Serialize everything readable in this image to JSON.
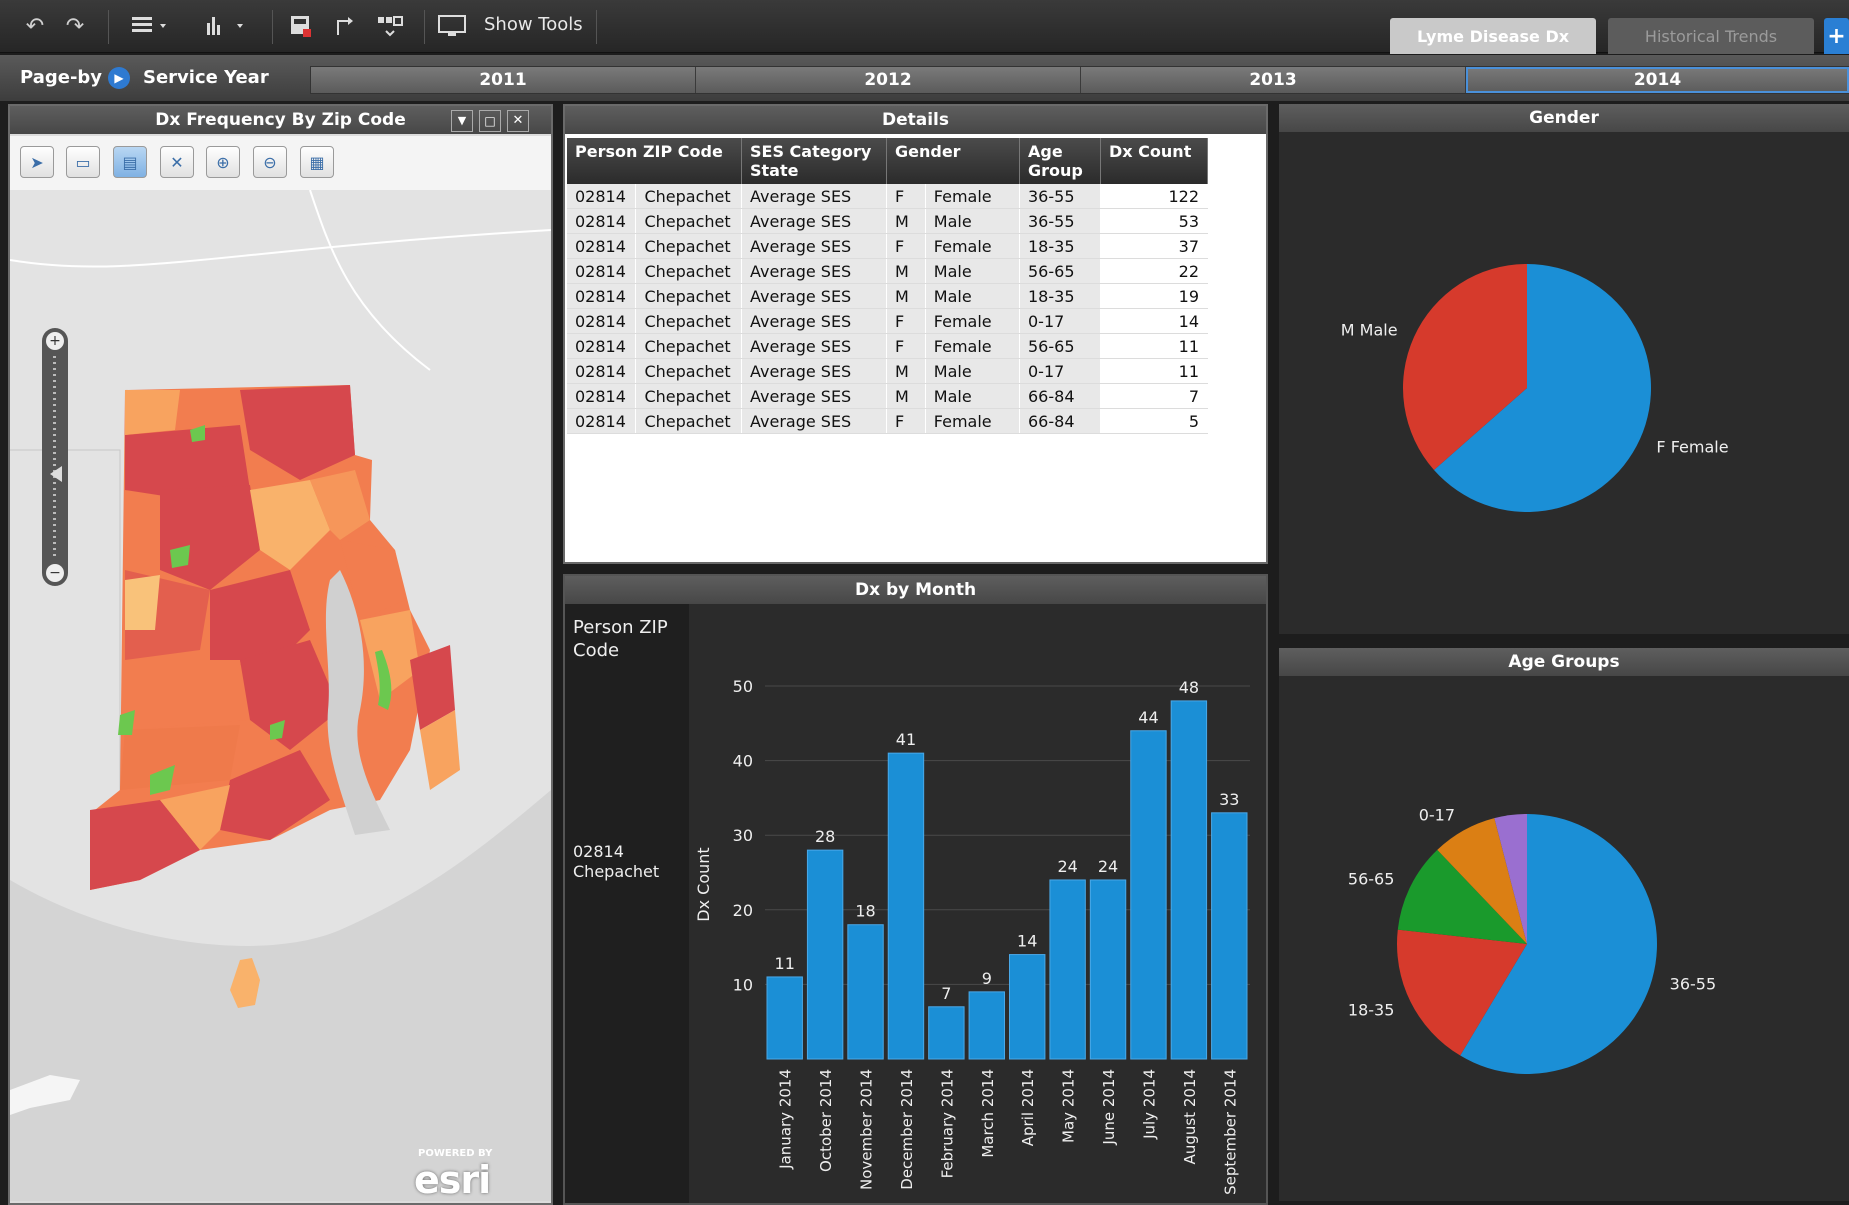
{
  "toolbar": {
    "show_tools_label": "Show Tools",
    "doc_tabs": [
      "Lyme Disease Dx",
      "Historical Trends"
    ],
    "add_tab_label": "+"
  },
  "pageby": {
    "label": "Page-by",
    "field": "Service Year",
    "years": [
      "2011",
      "2012",
      "2013",
      "2014"
    ],
    "selected": "2014"
  },
  "map": {
    "title": "Dx Frequency By Zip Code",
    "attribution_small": "POWERED BY",
    "attribution_logo": "esri"
  },
  "details": {
    "title": "Details",
    "headers": [
      "Person ZIP Code",
      "SES Category State",
      "Gender",
      "Age Group",
      "Dx Count"
    ],
    "rows": [
      [
        "02814",
        "Chepachet",
        "Average SES",
        "F",
        "Female",
        "36-55",
        "122"
      ],
      [
        "02814",
        "Chepachet",
        "Average SES",
        "M",
        "Male",
        "36-55",
        "53"
      ],
      [
        "02814",
        "Chepachet",
        "Average SES",
        "F",
        "Female",
        "18-35",
        "37"
      ],
      [
        "02814",
        "Chepachet",
        "Average SES",
        "M",
        "Male",
        "56-65",
        "22"
      ],
      [
        "02814",
        "Chepachet",
        "Average SES",
        "M",
        "Male",
        "18-35",
        "19"
      ],
      [
        "02814",
        "Chepachet",
        "Average SES",
        "F",
        "Female",
        "0-17",
        "14"
      ],
      [
        "02814",
        "Chepachet",
        "Average SES",
        "F",
        "Female",
        "56-65",
        "11"
      ],
      [
        "02814",
        "Chepachet",
        "Average SES",
        "M",
        "Male",
        "0-17",
        "11"
      ],
      [
        "02814",
        "Chepachet",
        "Average SES",
        "M",
        "Male",
        "66-84",
        "7"
      ],
      [
        "02814",
        "Chepachet",
        "Average SES",
        "F",
        "Female",
        "66-84",
        "5"
      ]
    ]
  },
  "month_chart": {
    "title": "Dx by Month",
    "row_header": "Person ZIP Code",
    "row_value": "02814 Chepachet"
  },
  "gender_chart": {
    "title": "Gender"
  },
  "age_chart": {
    "title": "Age Groups"
  },
  "chart_data": [
    {
      "type": "bar",
      "title": "Dx by Month",
      "ylabel": "Dx Count",
      "xlabel": "",
      "categories": [
        "January 2014",
        "October 2014",
        "November 2014",
        "December 2014",
        "February 2014",
        "March 2014",
        "April 2014",
        "May 2014",
        "June 2014",
        "July 2014",
        "August 2014",
        "September 2014"
      ],
      "values": [
        11,
        28,
        18,
        41,
        7,
        9,
        14,
        24,
        24,
        44,
        48,
        33
      ],
      "yticks": [
        10,
        20,
        30,
        40,
        50
      ],
      "ylim": [
        0,
        50
      ],
      "color": "#1b8fd6",
      "grid": true
    },
    {
      "type": "pie",
      "title": "Gender",
      "labels": [
        "F Female",
        "M Male"
      ],
      "values": [
        63.5,
        36.5
      ],
      "colors": [
        "#1b8fd6",
        "#d63a2c"
      ]
    },
    {
      "type": "pie",
      "title": "Age Groups",
      "labels": [
        "36-55",
        "18-35",
        "56-65",
        "0-17",
        ""
      ],
      "values": [
        58,
        18,
        11,
        8,
        4
      ],
      "colors": [
        "#1b8fd6",
        "#d63a2c",
        "#1a9a2c",
        "#db7f14",
        "#9a6fd0"
      ]
    }
  ],
  "colors": {
    "bar": "#1b8fd6",
    "panel": "#2b2b2b",
    "map_high": "#d6484d",
    "map_mid": "#f27d4f",
    "map_low": "#f9b26b",
    "map_min": "#6cc84f"
  }
}
